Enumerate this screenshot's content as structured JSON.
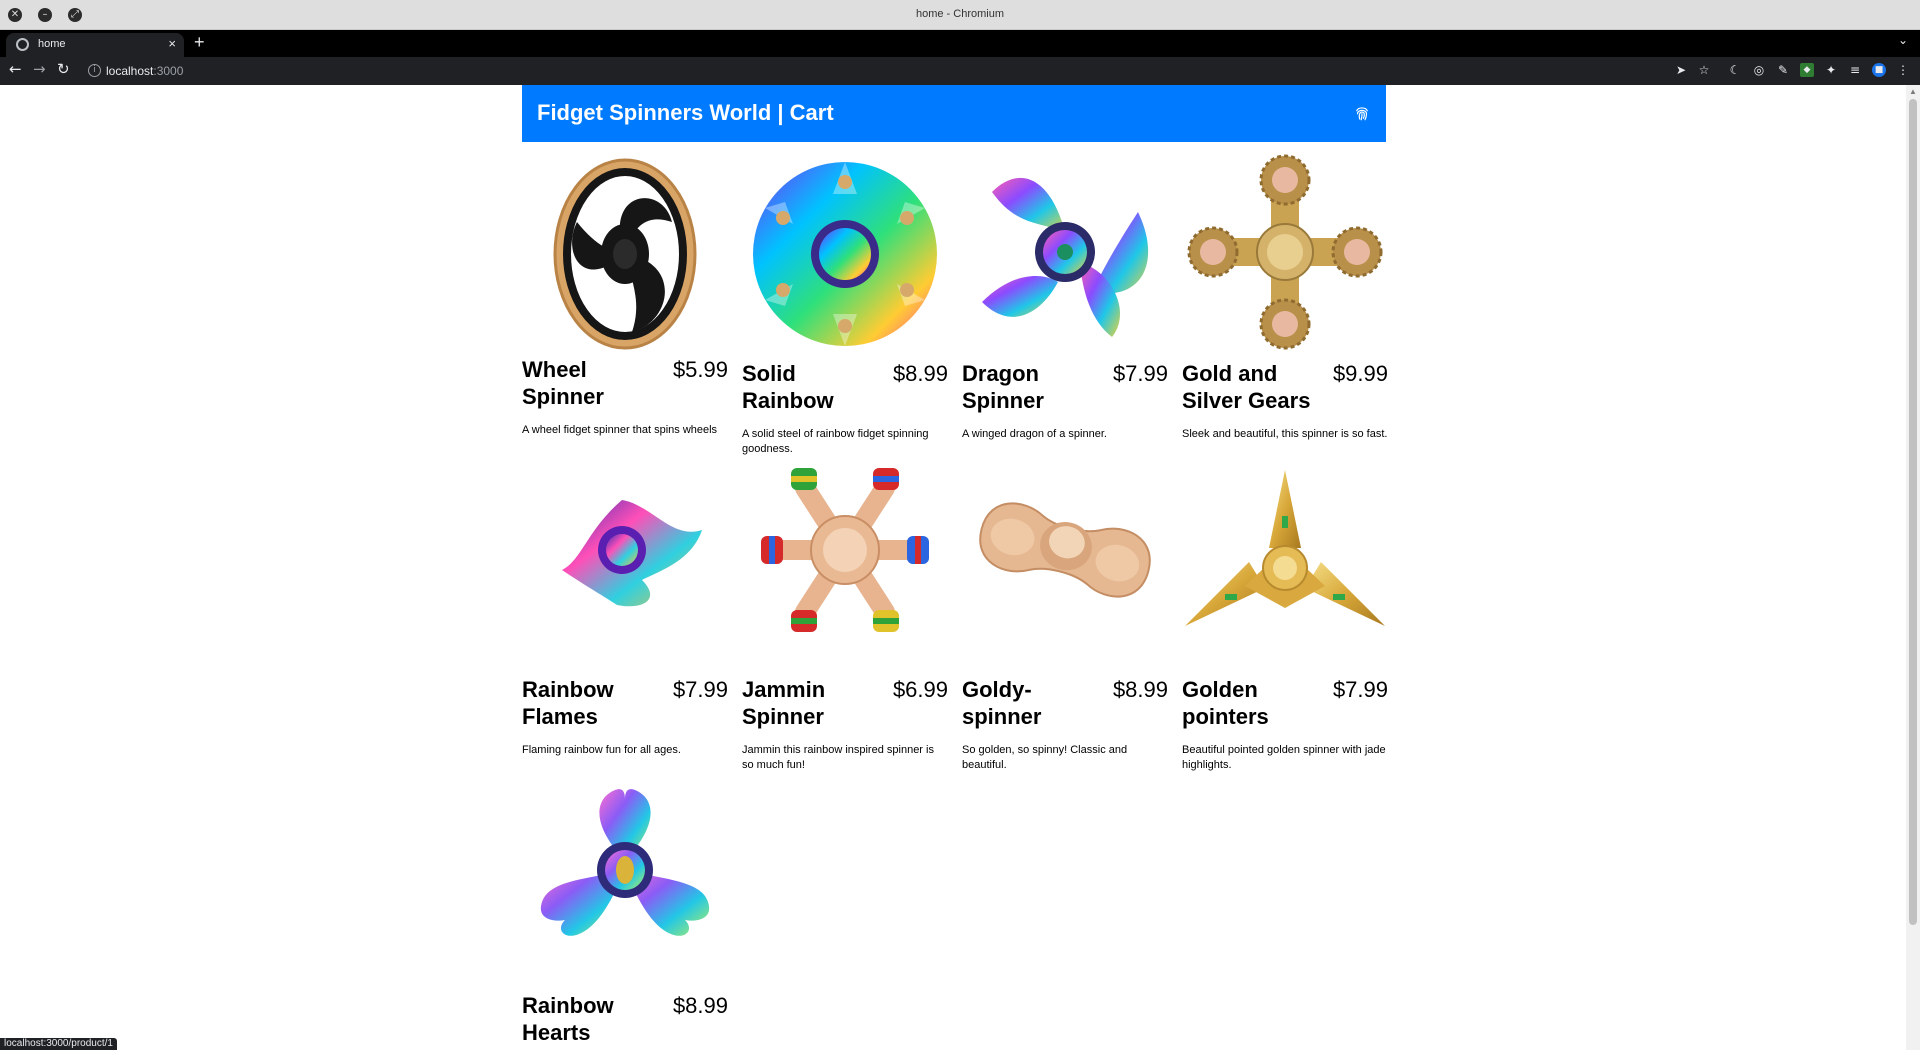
{
  "window": {
    "title": "home - Chromium"
  },
  "tab": {
    "title": "home"
  },
  "address": {
    "host": "localhost",
    "port": ":3000"
  },
  "header": {
    "title": "Fidget Spinners World | Cart"
  },
  "products": [
    {
      "name": "Wheel Spinner",
      "price": "$5.99",
      "description": "A wheel fidget spinner that spins wheels"
    },
    {
      "name": "Solid Rainbow",
      "price": "$8.99",
      "description": "A solid steel of rainbow fidget spinning goodness."
    },
    {
      "name": "Dragon Spinner",
      "price": "$7.99",
      "description": "A winged dragon of a spinner."
    },
    {
      "name": "Gold and Silver Gears",
      "price": "$9.99",
      "description": "Sleek and beautiful, this spinner is so fast."
    },
    {
      "name": "Rainbow Flames",
      "price": "$7.99",
      "description": "Flaming rainbow fun for all ages."
    },
    {
      "name": "Jammin Spinner",
      "price": "$6.99",
      "description": "Jammin this rainbow inspired spinner is so much fun!"
    },
    {
      "name": "Goldy-spinner",
      "price": "$8.99",
      "description": "So golden, so spinny! Classic and beautiful."
    },
    {
      "name": "Golden pointers",
      "price": "$7.99",
      "description": "Beautiful pointed golden spinner with jade highlights."
    },
    {
      "name": "Rainbow Hearts",
      "price": "$8.99",
      "description": ""
    }
  ],
  "status": {
    "link": "localhost:3000/product/1"
  },
  "colors": {
    "header": "#007bff",
    "gold": "#d9a566",
    "rainbow_a": "#7b2ff7",
    "rainbow_b": "#00c2ff"
  }
}
